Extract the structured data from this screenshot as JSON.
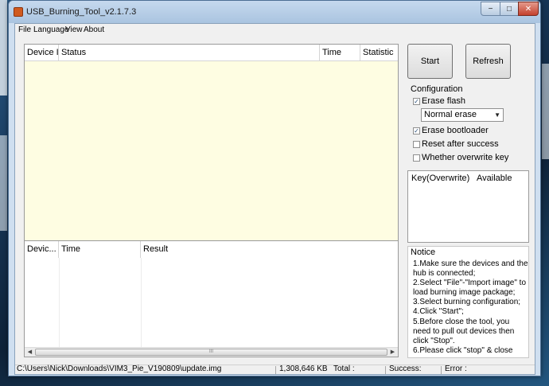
{
  "window": {
    "title": "USB_Burning_Tool_v2.1.7.3",
    "controls": {
      "minimize": "−",
      "maximize": "□",
      "close": "✕"
    }
  },
  "menu": [
    "File",
    "Language",
    "View",
    "About"
  ],
  "device_table": {
    "columns": [
      "Device ID",
      "Status",
      "Time",
      "Statistic"
    ],
    "rows": []
  },
  "result_table": {
    "columns": [
      "Devic...",
      "Time",
      "Result"
    ],
    "rows": [],
    "scroll_thumb_grip": "III"
  },
  "buttons": {
    "start": "Start",
    "refresh": "Refresh"
  },
  "configuration": {
    "title": "Configuration",
    "erase_flash": {
      "label": "Erase flash",
      "checked": true
    },
    "erase_mode": {
      "selected": "Normal erase"
    },
    "erase_bootloader": {
      "label": "Erase bootloader",
      "checked": true
    },
    "reset_after_success": {
      "label": "Reset after success",
      "checked": false
    },
    "overwrite_key": {
      "label": "Whether overwrite key",
      "checked": false
    }
  },
  "key_table": {
    "columns": [
      "Key(Overwrite)",
      "Available"
    ]
  },
  "notice": {
    "title": "Notice",
    "text": "1.Make sure the devices and the hub is connected;\n2.Select \"File\"-\"Import image\" to load burning image package;\n3.Select burning configuration;\n4.Click \"Start\";\n5.Before close the tool, you need to pull out devices then click \"Stop\".\n6.Please click \"stop\" & close"
  },
  "statusbar": {
    "path": "C:\\Users\\Nick\\Downloads\\VIM3_Pie_V190809\\update.img",
    "size": "1,308,646 KB",
    "total": "Total :",
    "success": "Success:",
    "error": "Error :"
  },
  "colors": {
    "device_table_bg": "#fefde2",
    "window_frame": "#cfdff0",
    "close_button": "#c4412d"
  }
}
